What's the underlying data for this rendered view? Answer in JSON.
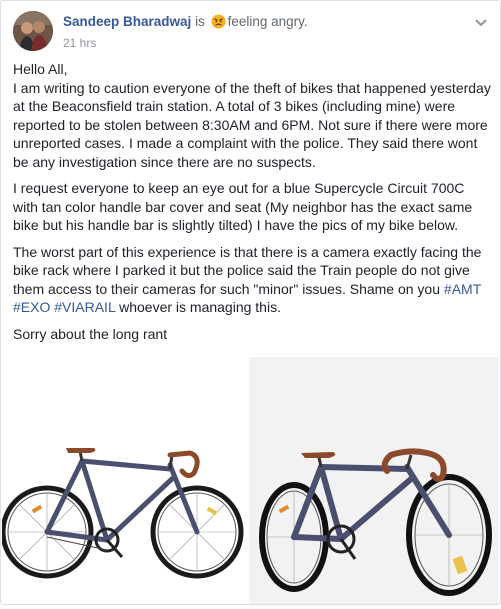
{
  "author": {
    "name": "Sandeep Bharadwaj",
    "is_word": "is",
    "feeling": "feeling angry.",
    "time": "21 hrs"
  },
  "post": {
    "greeting": "Hello All,",
    "para1": "I am writing to caution everyone of the theft of bikes that happened yesterday at the Beaconsfield train station. A total of 3 bikes (including mine) were reported to be stolen between 8:30AM and 6PM. Not sure if there were more unreported cases. I made a complaint with the police. They said there wont be any investigation since there are no suspects.",
    "para2": "I request everyone to keep an eye out for a blue Supercycle Circuit 700C with tan color handle bar cover and seat (My neighbor has the exact same bike but his handle bar is slightly tilted) I have the pics of my bike below.",
    "para3_text": "The worst part of this experience is that there is a camera exactly facing the bike rack where I parked it but the police said the Train people do not give them access to their cameras for such \"minor\" issues. Shame on you ",
    "hashtags": [
      "#AMT",
      "#EXO",
      "#VIARAIL"
    ],
    "para3_tail": " whoever is managing this.",
    "closing": "Sorry about the long rant"
  },
  "icons": {
    "feeling_emoji": "angry-face-icon",
    "menu": "chevron-down-icon"
  },
  "colors": {
    "name_link": "#385898",
    "hashtag": "#365899",
    "meta_text": "#90949c",
    "emoji_fill": "#f7b125",
    "bike_frame": "#4a4f6e"
  }
}
